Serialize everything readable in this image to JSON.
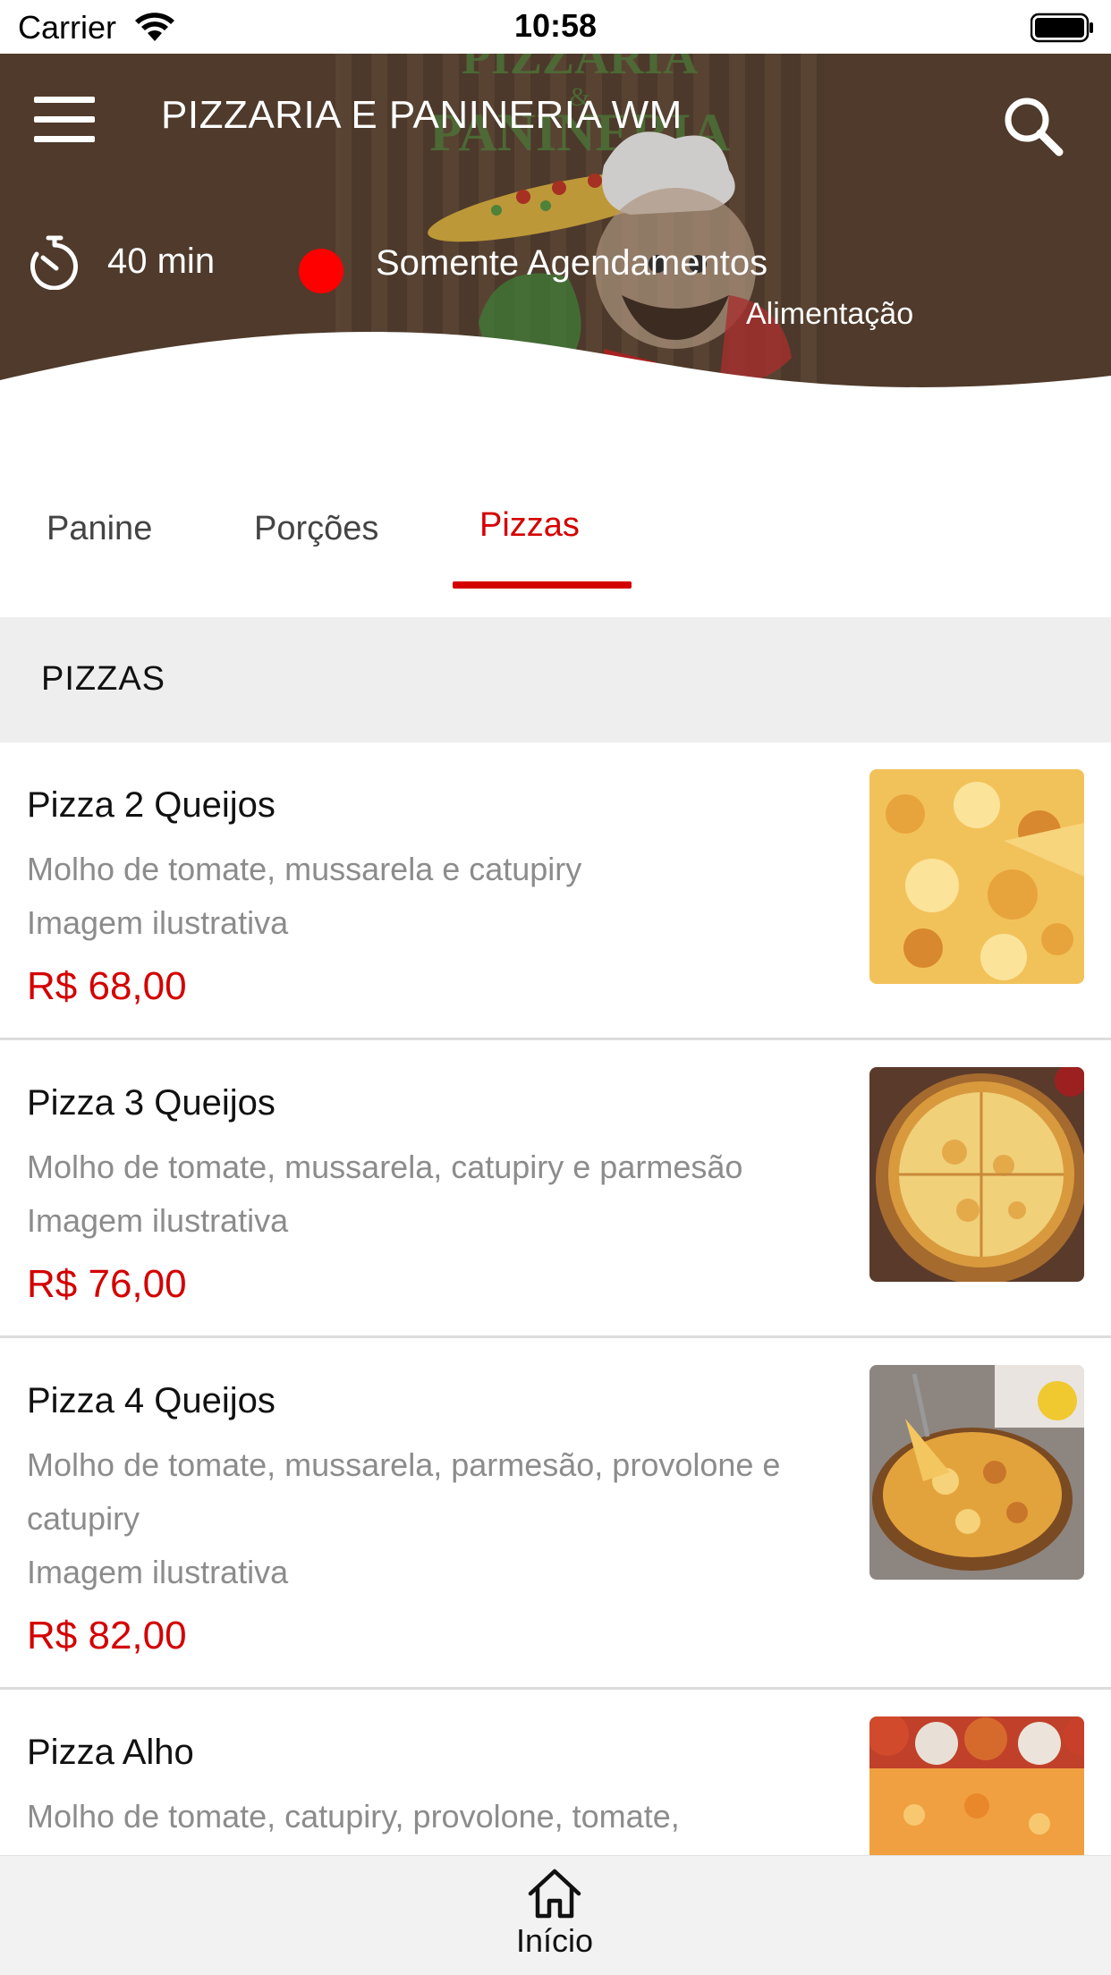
{
  "status_bar": {
    "carrier": "Carrier",
    "time": "10:58"
  },
  "header": {
    "title": "PIZZARIA E PANINERIA WM",
    "delivery_time": "40 min",
    "status_text": "Somente Agendamentos",
    "status_color": "#ff0000",
    "category": "Alimentação",
    "logo_text": [
      "PIZZARIA",
      "&",
      "PANINERIA"
    ],
    "background_color": "#4f3a2b"
  },
  "icons": {
    "menu": "hamburger-menu-icon",
    "search": "search-icon",
    "timer": "timer-icon",
    "home": "home-icon"
  },
  "tabs": [
    {
      "label": "Panine",
      "active": false
    },
    {
      "label": "Porções",
      "active": false
    },
    {
      "label": "Pizzas",
      "active": true
    }
  ],
  "accent_color": "#d40000",
  "section": {
    "title": "PIZZAS"
  },
  "products": [
    {
      "name": "Pizza 2 Queijos",
      "description": "Molho de tomate, mussarela e catupiry",
      "note": "Imagem ilustrativa",
      "price": "R$ 68,00"
    },
    {
      "name": "Pizza 3 Queijos",
      "description": "Molho de tomate, mussarela, catupiry e parmesão",
      "note": "Imagem ilustrativa",
      "price": "R$ 76,00"
    },
    {
      "name": "Pizza 4 Queijos",
      "description": "Molho de tomate, mussarela, parmesão, provolone e catupiry",
      "note": "Imagem ilustrativa",
      "price": "R$ 82,00"
    },
    {
      "name": "Pizza Alho",
      "description": "Molho de tomate, catupiry, provolone, tomate,",
      "note": "",
      "price": ""
    }
  ],
  "bottom_nav": {
    "home_label": "Início"
  }
}
